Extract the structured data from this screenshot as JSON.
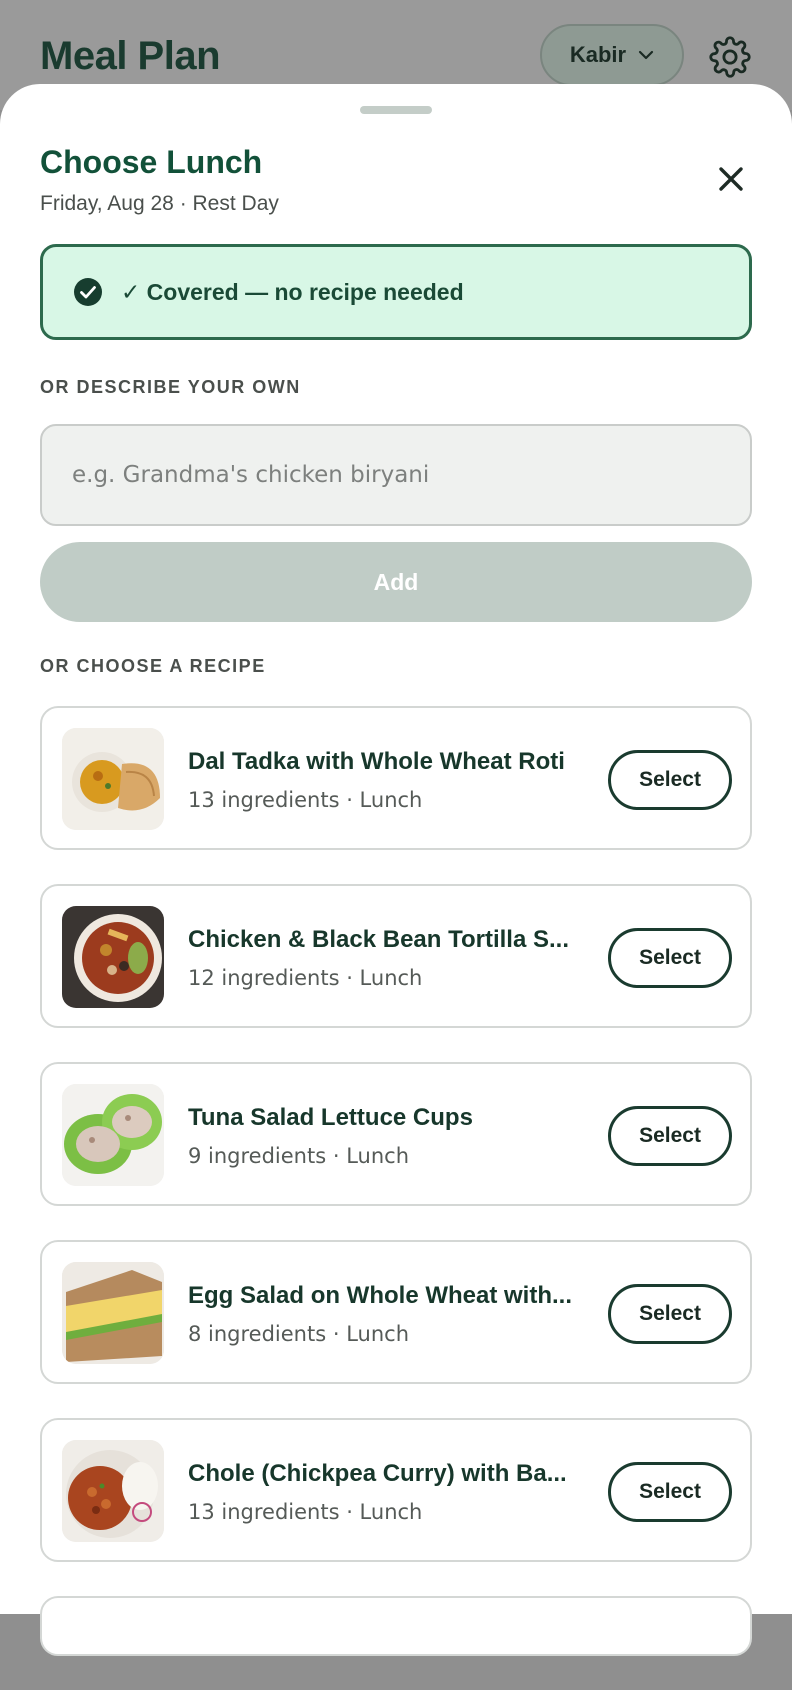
{
  "header": {
    "title": "Meal Plan",
    "user_name": "Kabir"
  },
  "sheet": {
    "title": "Choose Lunch",
    "subtitle": "Friday, Aug 28 · Rest Day",
    "covered_text": "✓ Covered — no recipe needed",
    "describe_label": "OR DESCRIBE YOUR OWN",
    "describe_placeholder": "e.g. Grandma's chicken biryani",
    "add_label": "Add",
    "choose_label": "OR CHOOSE A RECIPE"
  },
  "recipes": [
    {
      "name": "Dal Tadka with Whole Wheat Roti",
      "meta": "13 ingredients · Lunch",
      "select_label": "Select"
    },
    {
      "name": "Chicken & Black Bean Tortilla S...",
      "meta": "12 ingredients · Lunch",
      "select_label": "Select"
    },
    {
      "name": "Tuna Salad Lettuce Cups",
      "meta": "9 ingredients · Lunch",
      "select_label": "Select"
    },
    {
      "name": "Egg Salad on Whole Wheat with...",
      "meta": "8 ingredients · Lunch",
      "select_label": "Select"
    },
    {
      "name": "Chole (Chickpea Curry) with Ba...",
      "meta": "13 ingredients · Lunch",
      "select_label": "Select"
    }
  ],
  "colors": {
    "brand_green": "#125139",
    "covered_bg": "#d8f7e6",
    "covered_border": "#2d6a4d",
    "add_disabled": "#c0ccc6"
  },
  "icons": {
    "user_dropdown": "chevron-down-icon",
    "settings": "gear-icon",
    "close": "close-icon",
    "covered": "check-circle-icon"
  }
}
